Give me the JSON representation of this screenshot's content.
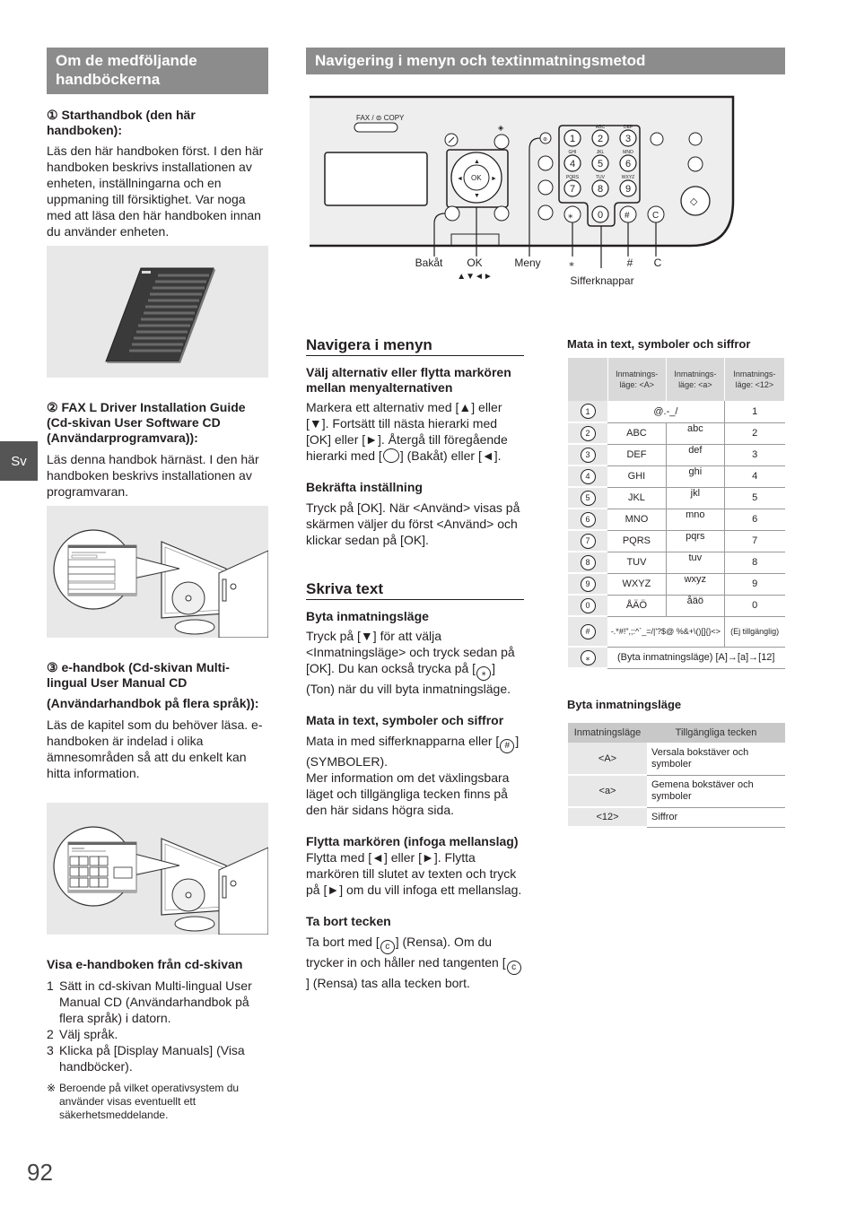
{
  "side_tab": "Sv",
  "page_number": "92",
  "left": {
    "banner": "Om de medföljande handböckerna",
    "item1": {
      "title": "① Starthandbok (den här handboken):",
      "body": "Läs den här handboken först. I den här handboken beskrivs installationen av enheten, inställningarna och en uppmaning till försiktighet. Var noga med att läsa den här handboken innan du använder enheten."
    },
    "item2": {
      "title": "② FAX L Driver Installation Guide (Cd-skivan User Software CD (Användarprogramvara)):",
      "body": "Läs denna handbok härnäst. I den här handboken beskrivs installationen av programvaran."
    },
    "item3": {
      "title_a": "③ e-handbok (Cd-skivan Multi-lingual User Manual CD",
      "title_b": "(Användarhandbok på flera språk)):",
      "body": "Läs de kapitel som du behöver läsa. e-handboken är indelad i olika ämnesområden så att du enkelt kan hitta information."
    },
    "visa": {
      "title": "Visa e-handboken från cd-skivan",
      "steps": [
        {
          "n": "1",
          "text": "Sätt in cd-skivan Multi-lingual User Manual CD (Användarhandbok på flera språk) i datorn."
        },
        {
          "n": "2",
          "text": "Välj språk."
        },
        {
          "n": "3",
          "text": "Klicka på [Display Manuals] (Visa handböcker)."
        }
      ],
      "note_mark": "※",
      "note": "Beroende på vilket operativsystem du använder visas eventuellt ett säkerhetsmeddelande."
    }
  },
  "right": {
    "banner": "Navigering i menyn och textinmatningsmetod",
    "panel": {
      "fax_copy_label": "FAX / COPY",
      "keys": [
        "1",
        "2",
        "3",
        "4",
        "5",
        "6",
        "7",
        "8",
        "9",
        "0"
      ],
      "key_letters": {
        "2": "ABC",
        "3": "DEF",
        "4": "GHI",
        "5": "JKL",
        "6": "MNO",
        "7": "PQRS",
        "8": "TUV",
        "9": "WXYZ"
      },
      "ok_label": "OK",
      "labels": {
        "back": "Bakåt",
        "ok": "OK",
        "arrows": "▲▼◄►",
        "menu": "Meny",
        "star": "⁎",
        "hash": "#",
        "clear": "C",
        "numkeys": "Sifferknappar"
      }
    },
    "nav": {
      "title": "Navigera i menyn",
      "sub1": "Välj alternativ eller flytta markören mellan menyalternativen",
      "body1_a": "Markera ett alternativ med [▲] eller [▼]. Fortsätt till nästa hierarki med [OK] eller [►]. Återgå till föregående hierarki med [",
      "body1_b": "] (Bakåt) eller [◄].",
      "sub2": "Bekräfta inställning",
      "body2": "Tryck på [OK]. När <Använd> visas på skärmen väljer du först <Använd> och klickar sedan på [OK]."
    },
    "write": {
      "title": "Skriva text",
      "sub1": "Byta inmatningsläge",
      "body1_a": "Tryck på [▼] för att välja <Inmatningsläge> och tryck sedan på [OK]. Du kan också trycka på [",
      "body1_icon": "⁎",
      "body1_b": "] (Ton) när du vill byta inmatningsläge.",
      "sub2": "Mata in text, symboler och siffror",
      "body2_a": "Mata in med sifferknapparna eller [",
      "body2_icon": "#",
      "body2_b": "] (SYMBOLER).",
      "body2_c": "Mer information om det växlingsbara läget och tillgängliga tecken finns på den här sidans högra sida.",
      "sub3": "Flytta markören (infoga mellanslag)",
      "body3": "Flytta med [◄] eller [►]. Flytta markören till slutet av texten och tryck på [►] om du vill infoga ett mellanslag.",
      "sub4": "Ta bort tecken",
      "body4_a": "Ta bort med [",
      "body4_icon": "c",
      "body4_b": "] (Rensa). Om du trycker in och håller ned tangenten [",
      "body4_c": "] (Rensa) tas alla tecken bort."
    },
    "char_table": {
      "title": "Mata in text, symboler och siffror",
      "headers": [
        "",
        "Inmatnings-läge: <A>",
        "Inmatnings-läge: <a>",
        "Inmatnings-läge: <12>"
      ],
      "rows": [
        {
          "key": "1",
          "A": "@.-_/",
          "a": "",
          "n": "1",
          "merged": true
        },
        {
          "key": "2",
          "A": "ABC",
          "a": "abc",
          "n": "2"
        },
        {
          "key": "3",
          "A": "DEF",
          "a": "def",
          "n": "3"
        },
        {
          "key": "4",
          "A": "GHI",
          "a": "ghi",
          "n": "4"
        },
        {
          "key": "5",
          "A": "JKL",
          "a": "jkl",
          "n": "5"
        },
        {
          "key": "6",
          "A": "MNO",
          "a": "mno",
          "n": "6"
        },
        {
          "key": "7",
          "A": "PQRS",
          "a": "pqrs",
          "n": "7"
        },
        {
          "key": "8",
          "A": "TUV",
          "a": "tuv",
          "n": "8"
        },
        {
          "key": "9",
          "A": "WXYZ",
          "a": "wxyz",
          "n": "9"
        },
        {
          "key": "0",
          "A": "ÅÄÖ",
          "a": "åäö",
          "n": "0"
        },
        {
          "key": "#",
          "A": "-.*#!\",;:^`_=/|'?$@ %&+\\()[]{}<>",
          "a": "",
          "n": "(Ej tillgänglig)",
          "merged": true
        },
        {
          "key": "⁎",
          "A": "(Byta inmatningsläge) [A]→[a]→[12]",
          "a": "",
          "n": "",
          "merged_all": true
        }
      ]
    },
    "mode_table": {
      "title": "Byta inmatningsläge",
      "headers": [
        "Inmatningsläge",
        "Tillgängliga tecken"
      ],
      "rows": [
        {
          "mode": "<A>",
          "desc": "Versala bokstäver och symboler"
        },
        {
          "mode": "<a>",
          "desc": "Gemena bokstäver och symboler"
        },
        {
          "mode": "<12>",
          "desc": "Siffror"
        }
      ]
    }
  }
}
